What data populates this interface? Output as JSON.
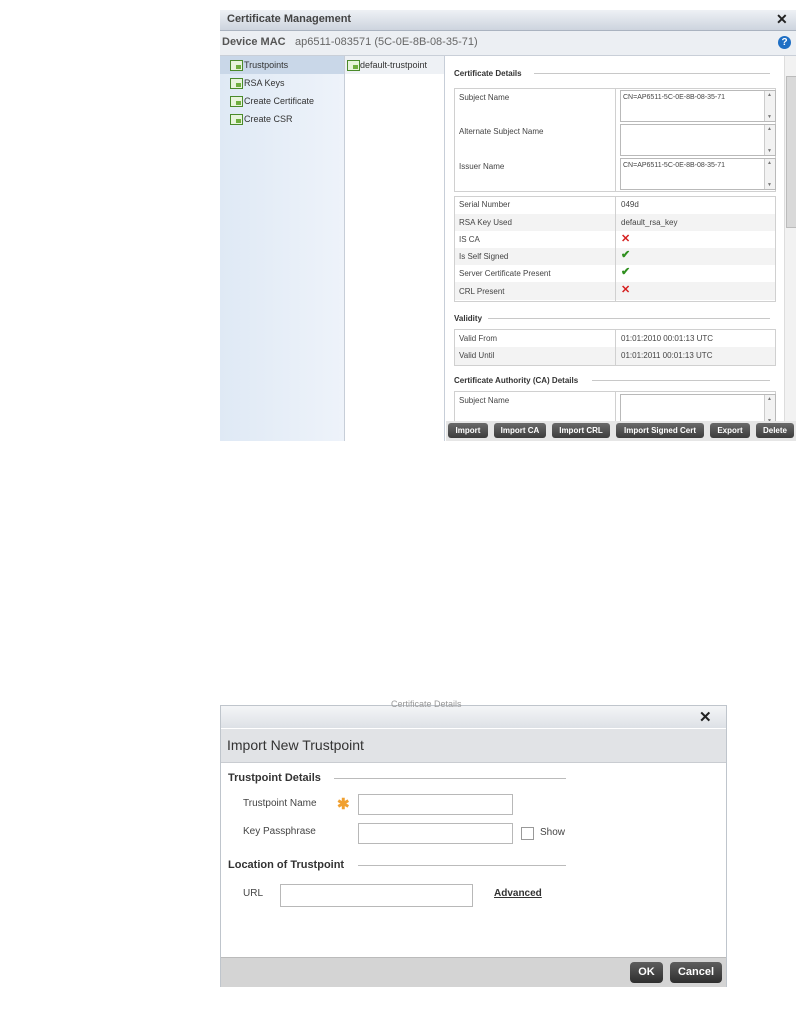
{
  "cert_window": {
    "title": "Certificate Management",
    "device_label": "Device MAC",
    "device_value": "ap6511-083571 (5C-0E-8B-08-35-71)",
    "tree": [
      {
        "label": "Trustpoints"
      },
      {
        "label": "RSA Keys"
      },
      {
        "label": "Create Certificate"
      },
      {
        "label": "Create CSR"
      }
    ],
    "trustpoints": [
      "default-trustpoint"
    ],
    "certificate_details_heading": "Certificate Details",
    "subject_name_label": "Subject Name",
    "subject_name_value": "CN=AP6511-5C-0E-8B-08-35-71",
    "alt_subject_label": "Alternate Subject Name",
    "alt_subject_value": "",
    "issuer_label": "Issuer Name",
    "issuer_value": "CN=AP6511-5C-0E-8B-08-35-71",
    "info_rows": [
      {
        "key": "Serial Number",
        "value": "049d"
      },
      {
        "key": "RSA Key Used",
        "value": "default_rsa_key"
      },
      {
        "key": "IS CA",
        "value": "✕",
        "status": "no"
      },
      {
        "key": "Is Self Signed",
        "value": "✔",
        "status": "yes"
      },
      {
        "key": "Server Certificate Present",
        "value": "✔",
        "status": "yes"
      },
      {
        "key": "CRL Present",
        "value": "✕",
        "status": "no"
      }
    ],
    "validity_heading": "Validity",
    "validity_rows": [
      {
        "key": "Valid From",
        "value": "01:01:2010 00:01:13 UTC"
      },
      {
        "key": "Valid Until",
        "value": "01:01:2011 00:01:13 UTC"
      }
    ],
    "ca_heading": "Certificate Authority (CA) Details",
    "ca_subject_label": "Subject Name",
    "buttons": {
      "import": "Import",
      "import_ca": "Import CA",
      "import_crl": "Import CRL",
      "import_signed": "Import Signed Cert",
      "export": "Export",
      "delete": "Delete"
    },
    "colors": {
      "yes": "#2f8f1e",
      "no": "#d62020",
      "help": "#1f6fc4"
    }
  },
  "import_window": {
    "ghost_text": "Certificate Details",
    "title": "Import New Trustpoint",
    "trustpoint_details_heading": "Trustpoint Details",
    "trustpoint_name_label": "Trustpoint Name",
    "trustpoint_name_value": "",
    "key_passphrase_label": "Key Passphrase",
    "key_passphrase_value": "",
    "show_label": "Show",
    "location_heading": "Location of Trustpoint",
    "url_label": "URL",
    "url_value": "",
    "advanced_label": "Advanced",
    "ok_label": "OK",
    "cancel_label": "Cancel",
    "required_color": "#f0a030"
  }
}
